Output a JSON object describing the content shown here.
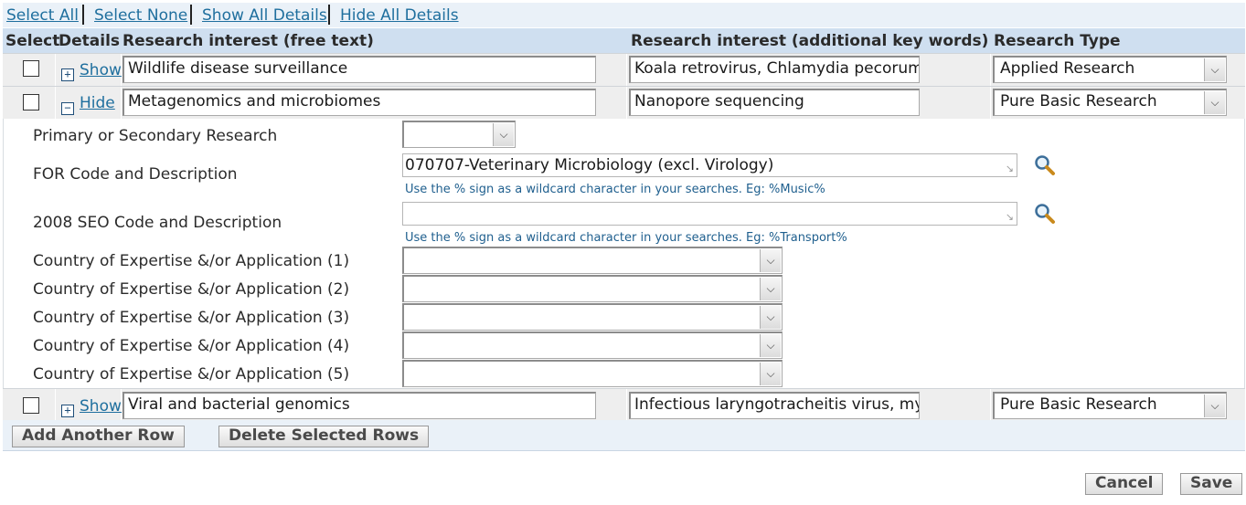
{
  "top_links": {
    "select_all": "Select All",
    "select_none": "Select None",
    "show_all": "Show All Details",
    "hide_all": "Hide All Details"
  },
  "columns": {
    "select": "Select",
    "details": "Details",
    "free_text": "Research interest (free text)",
    "keywords": "Research interest (additional key words)",
    "type": "Research Type"
  },
  "rows": [
    {
      "toggle": "Show",
      "toggle_sign": "+",
      "free_text": "Wildlife disease surveillance",
      "keywords": "Koala retrovirus, Chlamydia pecorum, v",
      "type": "Applied Research"
    },
    {
      "toggle": "Hide",
      "toggle_sign": "−",
      "free_text": "Metagenomics and microbiomes",
      "keywords": "Nanopore sequencing",
      "type": "Pure Basic Research"
    },
    {
      "toggle": "Show",
      "toggle_sign": "+",
      "free_text": "Viral and bacterial genomics",
      "keywords": "Infectious laryngotracheitis virus, mycc",
      "type": "Pure Basic Research"
    }
  ],
  "details": {
    "primary_label": "Primary or Secondary Research",
    "primary_value": "",
    "for_label": "FOR Code and Description",
    "for_value": "070707-Veterinary Microbiology (excl. Virology)",
    "for_hint": "Use the % sign as a wildcard character in your searches. Eg: %Music%",
    "seo_label": "2008 SEO Code and Description",
    "seo_value": "",
    "seo_hint": "Use the % sign as a wildcard character in your searches. Eg: %Transport%",
    "country_labels": [
      "Country of Expertise &/or Application (1)",
      "Country of Expertise &/or Application (2)",
      "Country of Expertise &/or Application (3)",
      "Country of Expertise &/or Application (4)",
      "Country of Expertise &/or Application (5)"
    ]
  },
  "buttons": {
    "add_row": "Add Another Row",
    "delete_rows": "Delete Selected Rows",
    "cancel": "Cancel",
    "save": "Save"
  },
  "icons": {
    "search": "search-icon",
    "dropdown": "chevron-down-icon",
    "expand": "plus-icon",
    "collapse": "minus-icon",
    "resize": "resize-handle-icon"
  },
  "colors": {
    "link": "#1f6f9e",
    "header_bg": "#cfdff0",
    "toolbar_bg": "#eaf1f8",
    "row_bg": "#eeeeee"
  }
}
